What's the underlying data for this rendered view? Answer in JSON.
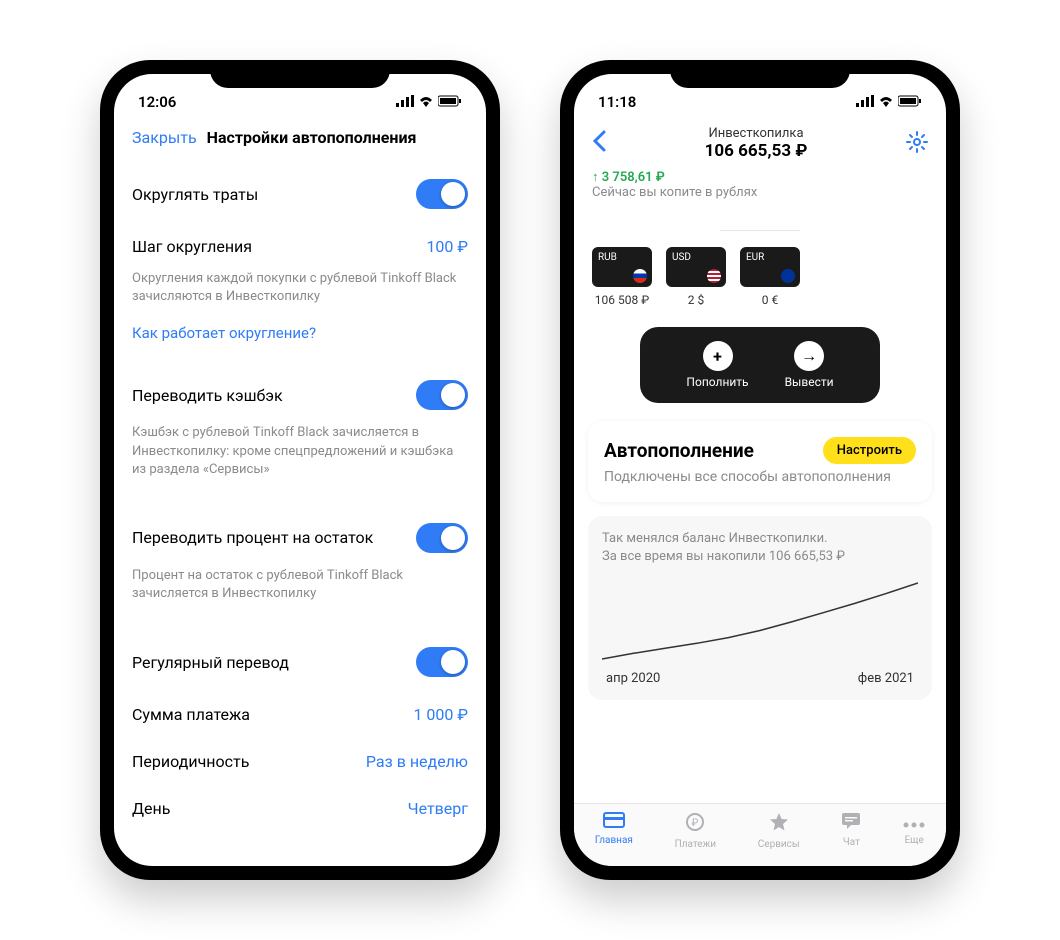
{
  "phone1": {
    "status_time": "12:06",
    "close": "Закрыть",
    "title": "Настройки автопополнения",
    "round": {
      "label": "Округлять траты",
      "step_label": "Шаг округления",
      "step_value": "100 ₽",
      "desc": "Округления каждой покупки с рублевой Tinkoff Black зачисляются в Инвесткопилку",
      "link": "Как работает округление?"
    },
    "cashback": {
      "label": "Переводить кэшбэк",
      "desc": "Кэшбэк с рублевой Tinkoff Black зачисляется в Инвесткопилку: кроме спецпредложений и кэшбэка из раздела «Сервисы»"
    },
    "interest": {
      "label": "Переводить процент на остаток",
      "desc": "Процент на остаток с рублевой Tinkoff Black зачисляется в Инвесткопилку"
    },
    "recurring": {
      "label": "Регулярный перевод",
      "amount_label": "Сумма платежа",
      "amount_value": "1 000 ₽",
      "period_label": "Периодичность",
      "period_value": "Раз в неделю",
      "day_label": "День",
      "day_value": "Четверг"
    }
  },
  "phone2": {
    "status_time": "11:18",
    "header_title": "Инвесткопилка",
    "balance": "106 665,53 ₽",
    "profit": "↑ 3 758,61 ₽",
    "subtext": "Сейчас вы копите в рублях",
    "currencies": [
      {
        "code": "RUB",
        "value": "106 508 ₽",
        "flag": "#0039a6,#d52b1e,#fff"
      },
      {
        "code": "USD",
        "value": "2 $",
        "flag": "#b22234,#3c3b6e,#fff"
      },
      {
        "code": "EUR",
        "value": "0 €",
        "flag": "#003399,#ffcc00,#003399"
      }
    ],
    "actions": {
      "deposit": "Пополнить",
      "withdraw": "Вывести"
    },
    "auto_card": {
      "title": "Автопополнение",
      "button": "Настроить",
      "desc": "Подключены все способы автопополнения"
    },
    "chart": {
      "text1": "Так менялся баланс Инвесткопилки.",
      "text2": "За все время вы накопили 106 665,53 ₽",
      "date_start": "апр 2020",
      "date_end": "фев 2021"
    },
    "tabs": [
      {
        "label": "Главная",
        "active": true
      },
      {
        "label": "Платежи",
        "active": false
      },
      {
        "label": "Сервисы",
        "active": false
      },
      {
        "label": "Чат",
        "active": false
      },
      {
        "label": "Еще",
        "active": false
      }
    ]
  },
  "chart_data": {
    "type": "line",
    "title": "",
    "xlabel": "",
    "ylabel": "",
    "x_range": [
      "апр 2020",
      "фев 2021"
    ],
    "y_range_hint": [
      0,
      106665
    ],
    "points": [
      {
        "x": 0.0,
        "y": 0
      },
      {
        "x": 0.1,
        "y": 8000
      },
      {
        "x": 0.2,
        "y": 15000
      },
      {
        "x": 0.3,
        "y": 22000
      },
      {
        "x": 0.4,
        "y": 30000
      },
      {
        "x": 0.5,
        "y": 40000
      },
      {
        "x": 0.6,
        "y": 52000
      },
      {
        "x": 0.7,
        "y": 65000
      },
      {
        "x": 0.8,
        "y": 78000
      },
      {
        "x": 0.9,
        "y": 92000
      },
      {
        "x": 1.0,
        "y": 106665
      }
    ]
  }
}
